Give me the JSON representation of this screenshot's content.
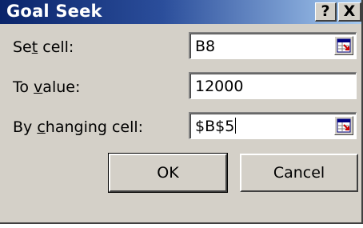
{
  "window": {
    "title": "Goal Seek",
    "help_glyph": "?",
    "close_glyph": "X"
  },
  "fields": [
    {
      "label_pre": "Se",
      "label_ul": "t",
      "label_post": " cell:",
      "value": "B8",
      "has_ref_button": true
    },
    {
      "label_pre": "To ",
      "label_ul": "v",
      "label_post": "alue:",
      "value": "12000",
      "has_ref_button": false
    },
    {
      "label_pre": "By ",
      "label_ul": "c",
      "label_post": "hanging cell:",
      "value": "$B$5",
      "has_ref_button": true
    }
  ],
  "buttons": {
    "ok": "OK",
    "cancel": "Cancel"
  },
  "icons": {
    "help": "help-icon",
    "close": "close-icon",
    "ref": "collapse-dialog-icon"
  },
  "colors": {
    "titlebar_start": "#0a246a",
    "titlebar_end": "#a6caf0",
    "face": "#d4d0c8"
  }
}
